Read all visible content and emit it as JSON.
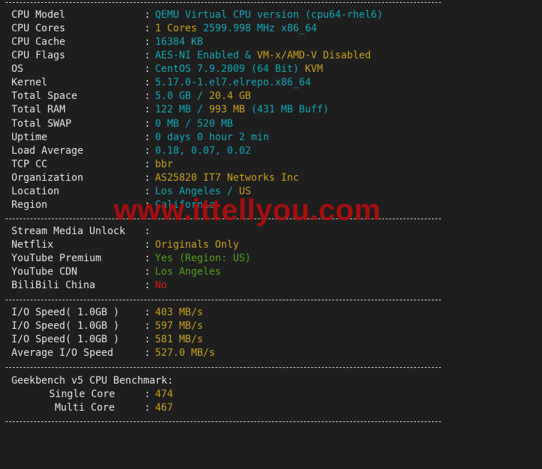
{
  "system": [
    {
      "label": "CPU Model",
      "parts": [
        {
          "text": "QEMU Virtual CPU version (cpu64-rhel6)",
          "color": "cyan"
        }
      ]
    },
    {
      "label": "CPU Cores",
      "parts": [
        {
          "text": "1 Cores",
          "color": "yellow"
        },
        {
          "text": " 2599.998 MHz x86_64",
          "color": "cyan"
        }
      ]
    },
    {
      "label": "CPU Cache",
      "parts": [
        {
          "text": "16384 KB",
          "color": "cyan"
        }
      ]
    },
    {
      "label": "CPU Flags",
      "parts": [
        {
          "text": "AES-NI Enabled & ",
          "color": "cyan"
        },
        {
          "text": "VM-x/AMD-V Disabled",
          "color": "yellow"
        }
      ]
    },
    {
      "label": "OS",
      "parts": [
        {
          "text": "CentOS 7.9.2009 (64 Bit) ",
          "color": "cyan"
        },
        {
          "text": "KVM",
          "color": "yellow"
        }
      ]
    },
    {
      "label": "Kernel",
      "parts": [
        {
          "text": "5.17.0-1.el7.elrepo.x86_64",
          "color": "cyan"
        }
      ]
    },
    {
      "label": "Total Space",
      "parts": [
        {
          "text": "5.0 GB / ",
          "color": "cyan"
        },
        {
          "text": "20.4 GB",
          "color": "yellow"
        }
      ]
    },
    {
      "label": "Total RAM",
      "parts": [
        {
          "text": "122 MB / ",
          "color": "cyan"
        },
        {
          "text": "993 MB",
          "color": "yellow"
        },
        {
          "text": " (431 MB Buff)",
          "color": "cyan"
        }
      ]
    },
    {
      "label": "Total SWAP",
      "parts": [
        {
          "text": "0 MB / 520 MB",
          "color": "cyan"
        }
      ]
    },
    {
      "label": "Uptime",
      "parts": [
        {
          "text": "0 days 0 hour 2 min",
          "color": "cyan"
        }
      ]
    },
    {
      "label": "Load Average",
      "parts": [
        {
          "text": "0.18, 0.07, 0.02",
          "color": "cyan"
        }
      ]
    },
    {
      "label": "TCP CC",
      "parts": [
        {
          "text": "bbr",
          "color": "yellow"
        }
      ]
    },
    {
      "label": "Organization",
      "parts": [
        {
          "text": "AS25820 IT7 Networks Inc",
          "color": "yellow"
        }
      ]
    },
    {
      "label": "Location",
      "parts": [
        {
          "text": "Los Angeles / ",
          "color": "cyan"
        },
        {
          "text": "US",
          "color": "yellow"
        }
      ]
    },
    {
      "label": "Region",
      "parts": [
        {
          "text": "California",
          "color": "cyan"
        }
      ]
    }
  ],
  "media": [
    {
      "label": "Stream Media Unlock",
      "parts": []
    },
    {
      "label": "Netflix",
      "parts": [
        {
          "text": "Originals Only",
          "color": "yellow"
        }
      ]
    },
    {
      "label": "YouTube Premium",
      "parts": [
        {
          "text": "Yes (Region: US)",
          "color": "green"
        }
      ]
    },
    {
      "label": "YouTube CDN",
      "parts": [
        {
          "text": "Los Angeles",
          "color": "green"
        }
      ]
    },
    {
      "label": "BiliBili China",
      "parts": [
        {
          "text": "No",
          "color": "red"
        }
      ]
    }
  ],
  "io": [
    {
      "label": "I/O Speed( 1.0GB )",
      "parts": [
        {
          "text": "403 MB/s",
          "color": "yellow"
        }
      ]
    },
    {
      "label": "I/O Speed( 1.0GB )",
      "parts": [
        {
          "text": "597 MB/s",
          "color": "yellow"
        }
      ]
    },
    {
      "label": "I/O Speed( 1.0GB )",
      "parts": [
        {
          "text": "581 MB/s",
          "color": "yellow"
        }
      ]
    },
    {
      "label": "Average I/O Speed",
      "parts": [
        {
          "text": "527.0 MB/s",
          "color": "yellow"
        }
      ]
    }
  ],
  "geekbench": {
    "title": "Geekbench v5 CPU Benchmark:",
    "single_label": "Single Core",
    "single_value": "474",
    "multi_label": "Multi Core",
    "multi_value": "467"
  },
  "colon": ":",
  "watermark": "www.ittellyou.com",
  "colors": {
    "background": "#1e1e1e",
    "cyan": "#11a8b7",
    "yellow": "#c9a21a",
    "green": "#4fa11d",
    "red": "#d11b1b",
    "watermark": "#b00d0d"
  }
}
